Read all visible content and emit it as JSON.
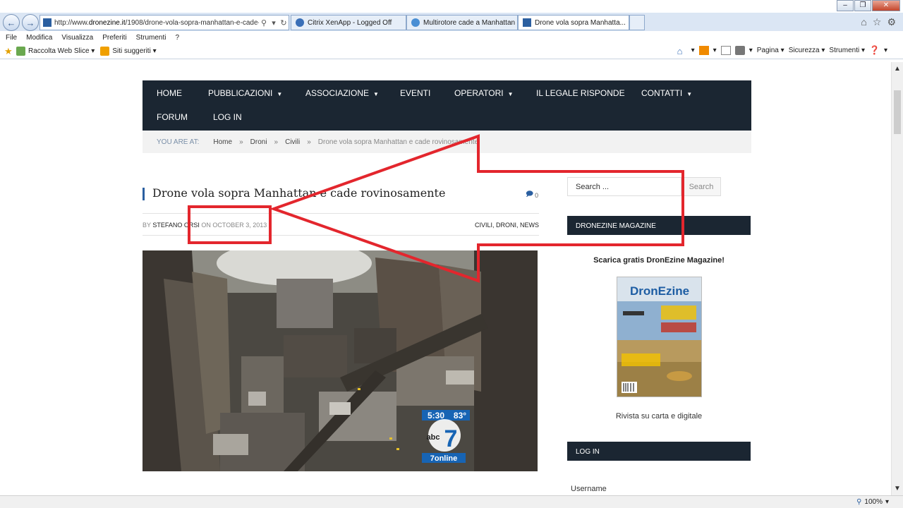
{
  "browser": {
    "address_url_prefix": "http://www.",
    "address_url_domain": "dronezine.it",
    "address_url_rest": "/1908/drone-vola-sopra-manhattan-e-cade-",
    "tabs": [
      {
        "label": "Citrix XenApp - Logged Off",
        "active": false
      },
      {
        "label": "Multirotore cade a Manhattan ...",
        "active": false
      },
      {
        "label": "Drone vola sopra Manhatta...",
        "active": true
      }
    ],
    "menu": [
      "File",
      "Modifica",
      "Visualizza",
      "Preferiti",
      "Strumenti",
      "?"
    ],
    "favorites": [
      {
        "label": "Raccolta Web Slice",
        "icon": "favorites-star-icon"
      },
      {
        "label": "Siti suggeriti",
        "icon": "suggested-sites-icon"
      }
    ],
    "commands": {
      "page": "Pagina",
      "safety": "Sicurezza",
      "tools": "Strumenti"
    },
    "zoom": "100%"
  },
  "site": {
    "nav": [
      {
        "label": "HOME",
        "has_dropdown": false
      },
      {
        "label": "PUBBLICAZIONI",
        "has_dropdown": true
      },
      {
        "label": "ASSOCIAZIONE",
        "has_dropdown": true
      },
      {
        "label": "EVENTI",
        "has_dropdown": false
      },
      {
        "label": "OPERATORI",
        "has_dropdown": true
      },
      {
        "label": "IL LEGALE RISPONDE",
        "has_dropdown": false
      },
      {
        "label": "CONTATTI",
        "has_dropdown": true
      },
      {
        "label": "FORUM",
        "has_dropdown": false
      },
      {
        "label": "LOG IN",
        "has_dropdown": false
      }
    ],
    "breadcrumb": {
      "prefix": "YOU ARE AT:",
      "items": [
        "Home",
        "Droni",
        "Civili"
      ],
      "separator": "»",
      "current": "Drone vola sopra Manhattan e cade rovinosamente"
    }
  },
  "post": {
    "title": "Drone vola sopra Manhattan e cade rovinosamente",
    "comments_count": "0",
    "by": "BY",
    "author": "STEFANO ORSI",
    "date_prefix": "ON",
    "date": "OCTOBER 3, 2013",
    "categories": [
      "CIVILI",
      "DRONI",
      "NEWS"
    ],
    "video_overlay": {
      "time": "5:30",
      "temp": "83°",
      "channel_number": "7",
      "network": "abc",
      "brand": "7online"
    }
  },
  "sidebar": {
    "search_placeholder": "Search ...",
    "search_button": "Search",
    "magazine_heading": "DRONEZINE MAGAZINE",
    "magazine_title": "Scarica gratis DronEzine Magazine!",
    "magazine_cover_logo": "DronEzine",
    "magazine_caption": "Rivista su carta e digitale",
    "login_heading": "LOG IN",
    "username_label": "Username"
  },
  "annotation": {
    "color": "#e3262d",
    "kind": "arrow-pointing-to-date"
  }
}
